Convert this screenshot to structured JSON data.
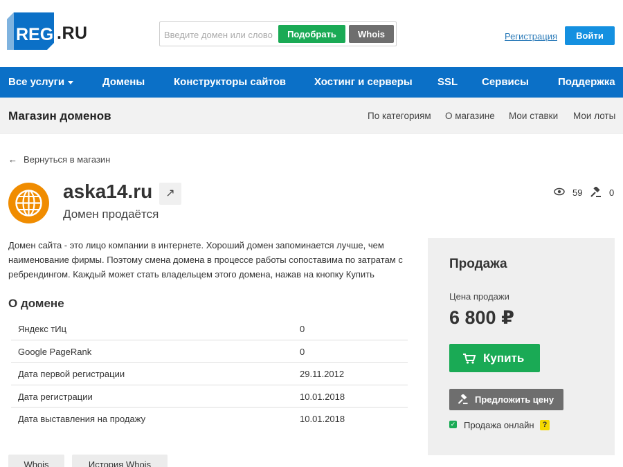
{
  "header": {
    "logo_text": "REG",
    "logo_suffix": ".RU",
    "search_placeholder": "Введите домен или слово",
    "pick_button": "Подобрать",
    "whois_button": "Whois",
    "register_link": "Регистрация",
    "login_button": "Войти"
  },
  "nav": {
    "items": [
      "Все услуги",
      "Домены",
      "Конструкторы сайтов",
      "Хостинг и серверы",
      "SSL",
      "Сервисы",
      "Поддержка"
    ]
  },
  "subbar": {
    "title": "Магазин доменов",
    "links": [
      "По категориям",
      "О магазине",
      "Мои ставки",
      "Мои лоты"
    ]
  },
  "back_link": "Вернуться в магазин",
  "domain": {
    "name": "aska14.ru",
    "status": "Домен продаётся",
    "views": "59",
    "bids": "0",
    "description": "Домен сайта - это лицо компании в интернете. Хороший домен запоминается лучше, чем наименование фирмы. Поэтому смена домена в процессе работы сопоставима по затратам с ребрендингом. Каждый может стать владельцем этого домена, нажав на кнопку Купить"
  },
  "about": {
    "title": "О домене",
    "rows": [
      {
        "label": "Яндекс тИц",
        "value": "0"
      },
      {
        "label": "Google PageRank",
        "value": "0"
      },
      {
        "label": "Дата первой регистрации",
        "value": "29.11.2012"
      },
      {
        "label": "Дата регистрации",
        "value": "10.01.2018"
      },
      {
        "label": "Дата выставления на продажу",
        "value": "10.01.2018"
      }
    ]
  },
  "bottom_buttons": [
    "Whois",
    "История Whois"
  ],
  "sale": {
    "title": "Продажа",
    "price_label": "Цена продажи",
    "price": "6 800 ₽",
    "buy_button": "Купить",
    "offer_button": "Предложить цену",
    "online_label": "Продажа онлайн",
    "online_checked": true,
    "help": "?"
  },
  "colors": {
    "nav_bg": "#0b70c7",
    "green": "#1aaa55",
    "login_blue": "#1490e0",
    "gray_button": "#6e6e6e",
    "domain_icon": "#f08c00"
  }
}
